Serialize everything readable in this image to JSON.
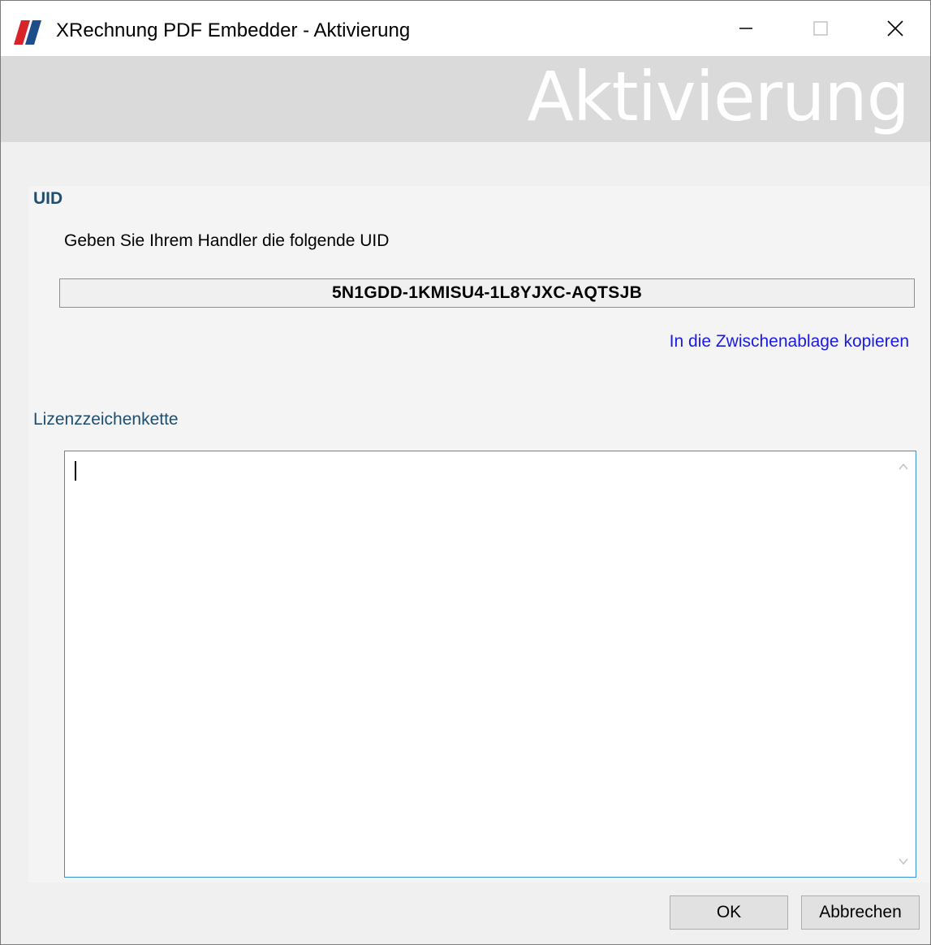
{
  "window": {
    "title": "XRechnung PDF Embedder - Aktivierung",
    "controls": {
      "minimize": "minimize-icon",
      "maximize": "maximize-icon",
      "close": "close-icon"
    }
  },
  "banner": {
    "title": "Aktivierung"
  },
  "uid_section": {
    "label": "UID",
    "instruction": "Geben Sie Ihrem Handler die folgende UID",
    "uid_value": "5N1GDD-1KMISU4-1L8YJXC-AQTSJB",
    "copy_link": "In die Zwischenablage kopieren"
  },
  "license_section": {
    "label": "Lizenzzeichenkette",
    "value": ""
  },
  "buttons": {
    "ok": "OK",
    "cancel": "Abbrechen"
  },
  "colors": {
    "banner_bg": "#dadada",
    "section_label": "#1f4e6e",
    "link": "#1a1ae6",
    "focus_border": "#3c8ed6",
    "logo_red": "#d9232a",
    "logo_blue": "#1d4e89"
  }
}
